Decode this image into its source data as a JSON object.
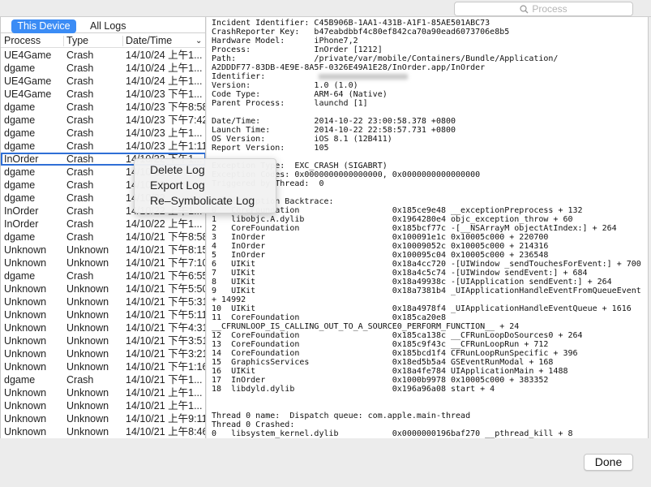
{
  "search": {
    "placeholder": "Process",
    "icon": "search-icon"
  },
  "tabs": [
    {
      "label": "This Device",
      "selected": true
    },
    {
      "label": "All Logs",
      "selected": false
    }
  ],
  "columns": [
    "Process",
    "Type",
    "Date/Time"
  ],
  "rows": [
    [
      "UE4Game",
      "Crash",
      "14/10/24 上午1..."
    ],
    [
      "dgame",
      "Crash",
      "14/10/24 上午1..."
    ],
    [
      "UE4Game",
      "Crash",
      "14/10/24 上午1..."
    ],
    [
      "UE4Game",
      "Crash",
      "14/10/23 下午1..."
    ],
    [
      "dgame",
      "Crash",
      "14/10/23 下午8:58"
    ],
    [
      "dgame",
      "Crash",
      "14/10/23 下午7:42"
    ],
    [
      "dgame",
      "Crash",
      "14/10/23 上午1..."
    ],
    [
      "dgame",
      "Crash",
      "14/10/23 上午1:11"
    ],
    [
      "InOrder",
      "Crash",
      "14/10/22 下午1..."
    ],
    [
      "dgame",
      "Crash",
      "14/10/22 ..."
    ],
    [
      "dgame",
      "Crash",
      "14/10/22 ..."
    ],
    [
      "dgame",
      "Crash",
      "14/10/22 ..."
    ],
    [
      "InOrder",
      "Crash",
      "14/10/22 上午1..."
    ],
    [
      "InOrder",
      "Crash",
      "14/10/22 上午1..."
    ],
    [
      "dgame",
      "Crash",
      "14/10/21 下午8:58"
    ],
    [
      "Unknown",
      "Unknown",
      "14/10/21 下午8:15"
    ],
    [
      "Unknown",
      "Unknown",
      "14/10/21 下午7:10"
    ],
    [
      "dgame",
      "Crash",
      "14/10/21 下午6:55"
    ],
    [
      "Unknown",
      "Unknown",
      "14/10/21 下午5:50"
    ],
    [
      "Unknown",
      "Unknown",
      "14/10/21 下午5:31"
    ],
    [
      "Unknown",
      "Unknown",
      "14/10/21 下午5:11"
    ],
    [
      "Unknown",
      "Unknown",
      "14/10/21 下午4:31"
    ],
    [
      "Unknown",
      "Unknown",
      "14/10/21 下午3:51"
    ],
    [
      "Unknown",
      "Unknown",
      "14/10/21 下午3:21"
    ],
    [
      "Unknown",
      "Unknown",
      "14/10/21 下午1:16"
    ],
    [
      "dgame",
      "Crash",
      "14/10/21 下午1..."
    ],
    [
      "Unknown",
      "Unknown",
      "14/10/21 上午1..."
    ],
    [
      "Unknown",
      "Unknown",
      "14/10/21 上午1..."
    ],
    [
      "Unknown",
      "Unknown",
      "14/10/21 上午9:11"
    ],
    [
      "Unknown",
      "Unknown",
      "14/10/21 上午8:46"
    ]
  ],
  "selected_row": 8,
  "log_lines": [
    "Incident Identifier: C45B906B-1AA1-431B-A1F1-85AE501ABC73",
    "CrashReporter Key:   b47eabdbbf4c80ef842ca70a90ead6073706e8b5",
    "Hardware Model:      iPhone7,2",
    "Process:             InOrder [1212]",
    "Path:                /private/var/mobile/Containers/Bundle/Application/",
    "A2DDDF77-83DB-4E9E-8A5F-0326E49A1E28/InOrder.app/InOrder",
    "Identifier:",
    "Version:             1.0 (1.0)",
    "Code Type:           ARM-64 (Native)",
    "Parent Process:      launchd [1]",
    "",
    "Date/Time:           2014-10-22 23:00:58.378 +0800",
    "Launch Time:         2014-10-22 22:58:57.731 +0800",
    "OS Version:          iOS 8.1 (12B411)",
    "Report Version:      105",
    "",
    "Exception Type:  EXC_CRASH (SIGABRT)",
    "Exception Codes: 0x0000000000000000, 0x0000000000000000",
    "Triggered by Thread:  0",
    "",
    "Last Exception Backtrace:",
    "0   CoreFoundation                   0x185ce9e48 __exceptionPreprocess + 132",
    "1   libobjc.A.dylib                  0x1964280e4 objc_exception_throw + 60",
    "2   CoreFoundation                   0x185bcf77c -[__NSArrayM objectAtIndex:] + 264",
    "3   InOrder                          0x100091e1c 0x10005c000 + 220700",
    "4   InOrder                          0x10009052c 0x10005c000 + 214316",
    "5   InOrder                          0x100095c04 0x10005c000 + 236548",
    "6   UIKit                            0x18a4cc720 -[UIWindow _sendTouchesForEvent:] + 700",
    "7   UIKit                            0x18a4c5c74 -[UIWindow sendEvent:] + 684",
    "8   UIKit                            0x18a49938c -[UIApplication sendEvent:] + 264",
    "9   UIKit                            0x18a7381b4 _UIApplicationHandleEventFromQueueEvent",
    "+ 14992",
    "10  UIKit                            0x18a4978f4 _UIApplicationHandleEventQueue + 1616",
    "11  CoreFoundation                   0x185ca20e8",
    "__CFRUNLOOP_IS_CALLING_OUT_TO_A_SOURCE0_PERFORM_FUNCTION__ + 24",
    "12  CoreFoundation                   0x185ca138c __CFRunLoopDoSources0 + 264",
    "13  CoreFoundation                   0x185c9f43c __CFRunLoopRun + 712",
    "14  CoreFoundation                   0x185bcd1f4 CFRunLoopRunSpecific + 396",
    "15  GraphicsServices                 0x18ed5b5a4 GSEventRunModal + 168",
    "16  UIKit                            0x18a4fe784 UIApplicationMain + 1488",
    "17  InOrder                          0x1000b9978 0x10005c000 + 383352",
    "18  libdyld.dylib                    0x196a96a08 start + 4",
    "",
    "",
    "Thread 0 name:  Dispatch queue: com.apple.main-thread",
    "Thread 0 Crashed:",
    "0   libsystem_kernel.dylib           0x0000000196baf270 __pthread_kill + 8"
  ],
  "context_menu": [
    "Delete Log",
    "Export Log",
    "Re–Symbolicate Log"
  ],
  "done_label": "Done",
  "colors": {
    "accent": "#3b8cf5",
    "selection_outline": "#2f6fd6"
  }
}
